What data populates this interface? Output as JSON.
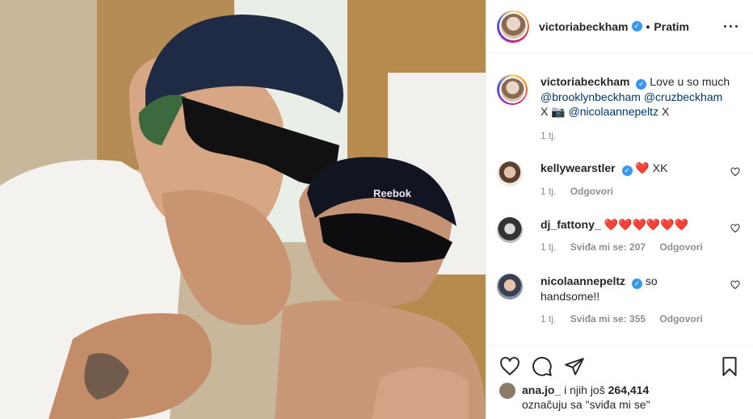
{
  "header": {
    "username": "victoriabeckham",
    "verified_mark": "✓",
    "separator": "•",
    "follow_status": "Pratim",
    "more_icon": "more-horizontal-icon"
  },
  "caption": {
    "username": "victoriabeckham",
    "text_1": "Love u so much",
    "mention_1": "@brooklynbeckham",
    "mention_2": "@cruzbeckham",
    "text_2": "X",
    "camera_emoji": "📷",
    "mention_3": "@nicolaannepeltz",
    "text_3": "X",
    "time": "1 tj."
  },
  "comments": [
    {
      "username": "kellywearstler",
      "hearts": "❤️",
      "text": "XK",
      "time": "1 tj.",
      "likes": "",
      "reply": "Odgovori"
    },
    {
      "username": "dj_fattony_",
      "hearts": "❤️❤️❤️❤️❤️❤️",
      "text": "",
      "time": "1 tj.",
      "likes": "Sviđa mi se: 207",
      "reply": "Odgovori"
    },
    {
      "username": "nicolaannepeltz",
      "hearts": "",
      "text_1": "so",
      "text_2": "handsome!!",
      "time": "1 tj.",
      "likes": "Sviđa mi se: 355",
      "reply": "Odgovori"
    }
  ],
  "likes": {
    "user": "ana.jo_",
    "middle": "i njih još",
    "count": "264,414",
    "suffix": "označuju sa \"sviđa mi se\""
  },
  "colors": {
    "link": "#00376b",
    "verified": "#3897f0",
    "meta": "#8e8e8e"
  }
}
